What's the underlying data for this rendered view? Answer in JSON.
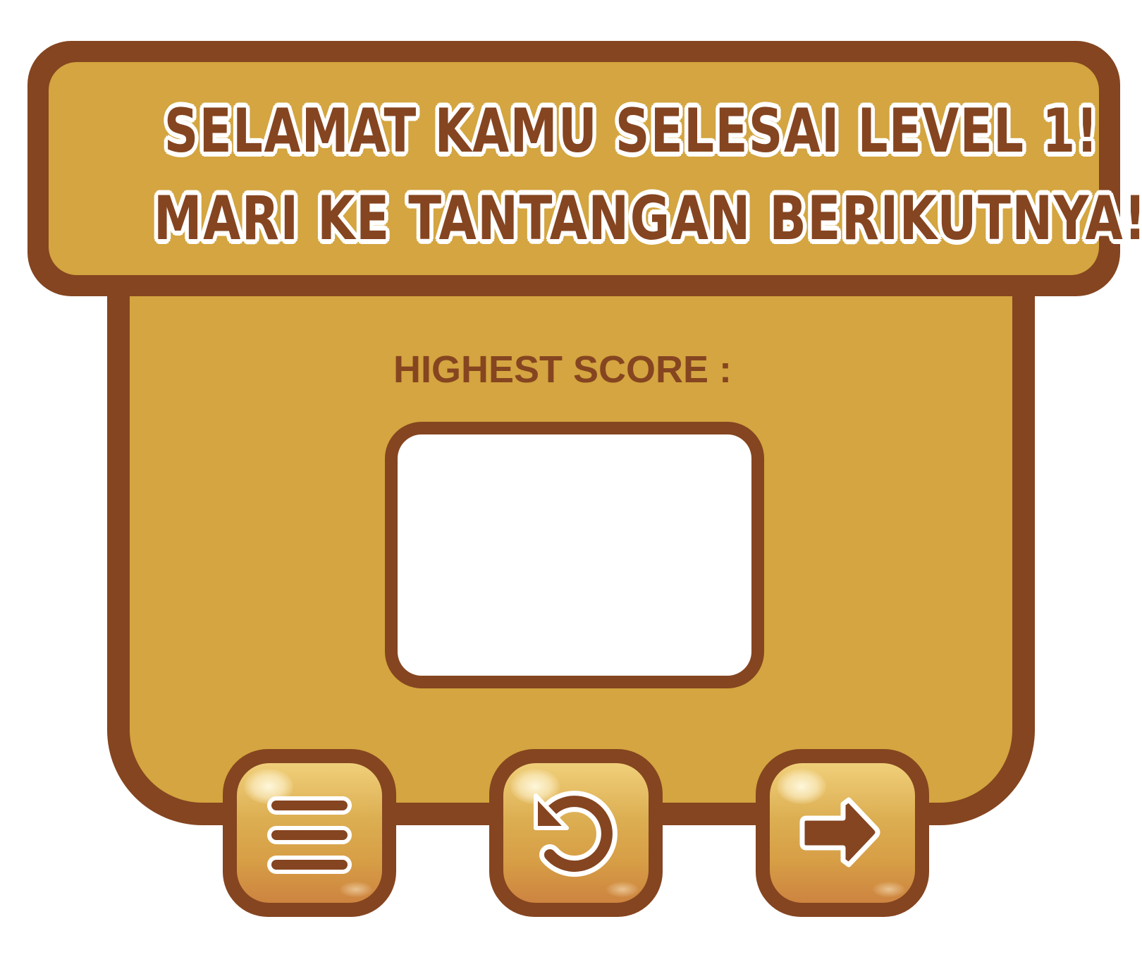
{
  "header": {
    "line1": "SELAMAT KAMU SELESAI LEVEL 1!",
    "line2": "MARI KE TANTANGAN BERIKUTNYA!"
  },
  "score": {
    "label": "HIGHEST SCORE :",
    "value": ""
  },
  "buttons": {
    "menu": {
      "icon": "menu-icon"
    },
    "retry": {
      "icon": "retry-icon"
    },
    "next": {
      "icon": "arrow-right-icon"
    }
  },
  "colors": {
    "panel": "#d4a540",
    "outline": "#854520",
    "box": "#ffffff"
  }
}
